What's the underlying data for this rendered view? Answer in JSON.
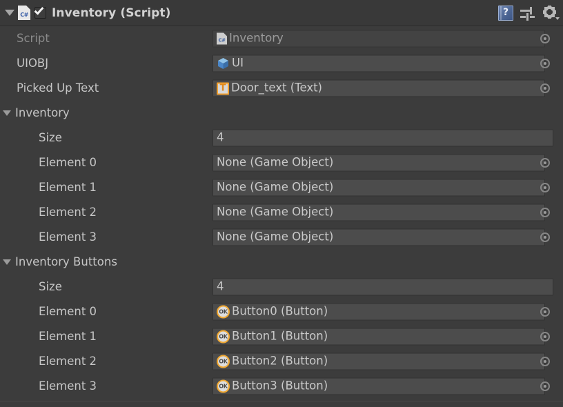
{
  "component": {
    "title": "Inventory (Script)",
    "enabled": true,
    "foldout_expanded": true,
    "script_icon": "csharp-script-icon",
    "header_icons": [
      {
        "name": "help-icon",
        "glyph": "?"
      },
      {
        "name": "preset-icon",
        "glyph": "sliders"
      },
      {
        "name": "settings-gear-icon",
        "glyph": "gear"
      }
    ]
  },
  "fields": {
    "script": {
      "label": "Script",
      "value": "Inventory",
      "icon": "csharp-script-icon",
      "disabled": true,
      "has_picker": true
    },
    "uiobj": {
      "label": "UIOBJ",
      "value": "UI",
      "icon": "prefab-cube-icon",
      "disabled": false,
      "has_picker": true
    },
    "picked_up_text": {
      "label": "Picked Up Text",
      "value": "Door_text (Text)",
      "icon": "text-component-icon",
      "disabled": false,
      "has_picker": true
    }
  },
  "arrays": [
    {
      "name": "inventory",
      "label": "Inventory",
      "expanded": true,
      "size_label": "Size",
      "size_value": "4",
      "elements": [
        {
          "label": "Element 0",
          "value": "None (Game Object)",
          "icon": null
        },
        {
          "label": "Element 1",
          "value": "None (Game Object)",
          "icon": null
        },
        {
          "label": "Element 2",
          "value": "None (Game Object)",
          "icon": null
        },
        {
          "label": "Element 3",
          "value": "None (Game Object)",
          "icon": null
        }
      ]
    },
    {
      "name": "inventory_buttons",
      "label": "Inventory Buttons",
      "expanded": true,
      "size_label": "Size",
      "size_value": "4",
      "elements": [
        {
          "label": "Element 0",
          "value": "Button0 (Button)",
          "icon": "button-ok-icon"
        },
        {
          "label": "Element 1",
          "value": "Button1 (Button)",
          "icon": "button-ok-icon"
        },
        {
          "label": "Element 2",
          "value": "Button2 (Button)",
          "icon": "button-ok-icon"
        },
        {
          "label": "Element 3",
          "value": "Button3 (Button)",
          "icon": "button-ok-icon"
        }
      ]
    }
  ],
  "icon_labels": {
    "csharp": "C#",
    "text": "T",
    "ok": "OK"
  },
  "colors": {
    "background": "#3c3c3c",
    "header_background": "#393939",
    "field_background": "#4c4c4c",
    "field_border": "#323232",
    "text": "#c6c6c6",
    "text_dim": "#8a8a8a",
    "accent_orange": "#f0a832",
    "accent_blue": "#4d6694"
  }
}
